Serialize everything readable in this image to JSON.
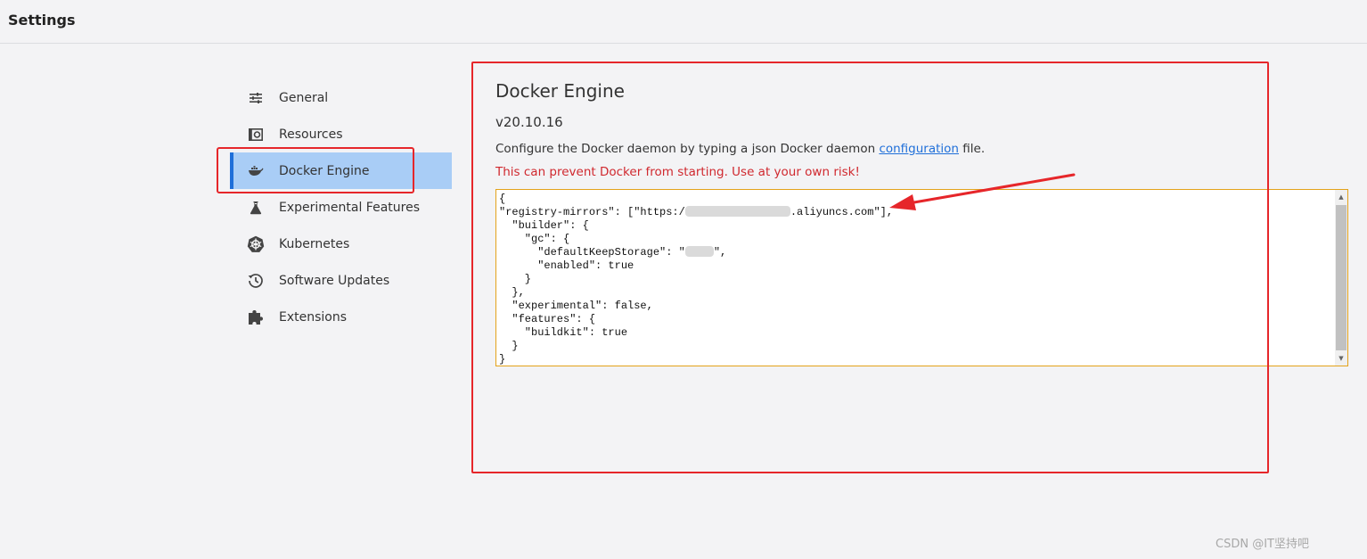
{
  "window": {
    "title": "Settings"
  },
  "sidebar": {
    "items": [
      {
        "label": "General",
        "icon": "sliders-icon"
      },
      {
        "label": "Resources",
        "icon": "resources-icon"
      },
      {
        "label": "Docker Engine",
        "icon": "whale-icon",
        "active": true
      },
      {
        "label": "Experimental Features",
        "icon": "flask-icon"
      },
      {
        "label": "Kubernetes",
        "icon": "helm-wheel-icon"
      },
      {
        "label": "Software Updates",
        "icon": "history-icon"
      },
      {
        "label": "Extensions",
        "icon": "puzzle-icon"
      }
    ]
  },
  "main": {
    "heading": "Docker Engine",
    "version": "v20.10.16",
    "description_prefix": "Configure the Docker daemon by typing a json Docker daemon ",
    "description_link": "configuration",
    "description_suffix": " file.",
    "warning": "This can prevent Docker from starting. Use at your own risk!",
    "config": {
      "line1": "{",
      "line2_a": "\"registry-mirrors\": [\"https:/",
      "line2_b": ".aliyuncs.com\"],",
      "line3": "  \"builder\": {",
      "line4": "    \"gc\": {",
      "line5_a": "      \"defaultKeepStorage\": \"",
      "line5_b": "\",",
      "line6": "      \"enabled\": true",
      "line7": "    }",
      "line8": "  },",
      "line9": "  \"experimental\": false,",
      "line10": "  \"features\": {",
      "line11": "    \"buildkit\": true",
      "line12": "  }",
      "line13": "}"
    }
  },
  "colors": {
    "annotation_red": "#e6262a",
    "active_bg": "#a9cdf6",
    "active_bar": "#1f6fd9",
    "link": "#1f6fd9",
    "warning": "#d0282e",
    "editor_border": "#e3a21a"
  },
  "watermark": "CSDN @IT坚持吧"
}
